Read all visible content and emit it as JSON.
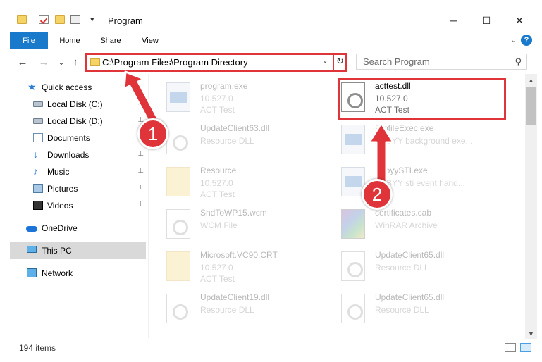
{
  "window": {
    "title": "Program",
    "minimize_glyph": "─",
    "maximize_glyph": "☐",
    "close_glyph": "✕",
    "qa_dropdown_glyph": "▾"
  },
  "ribbon": {
    "tabs": [
      "File",
      "Home",
      "Share",
      "View"
    ],
    "expand_glyph": "⌄",
    "help_glyph": "?"
  },
  "nav": {
    "back_glyph": "←",
    "forward_glyph": "→",
    "recent_glyph": "⌄",
    "up_glyph": "↑"
  },
  "address": {
    "path": "C:\\Program Files\\Program Directory",
    "dropdown_glyph": "⌄",
    "refresh_glyph": "↻"
  },
  "search": {
    "placeholder": "Search Program",
    "icon_glyph": "⚲"
  },
  "sidebar": {
    "items": [
      {
        "label": "Quick access",
        "icon": "star-icon",
        "pinned": false
      },
      {
        "label": "Local Disk (C:)",
        "icon": "disk-icon",
        "pinned": true
      },
      {
        "label": "Local Disk (D:)",
        "icon": "disk-icon",
        "pinned": true
      },
      {
        "label": "Documents",
        "icon": "documents-icon",
        "pinned": true
      },
      {
        "label": "Downloads",
        "icon": "download-icon",
        "pinned": true
      },
      {
        "label": "Music",
        "icon": "music-icon",
        "pinned": true
      },
      {
        "label": "Pictures",
        "icon": "pictures-icon",
        "pinned": true
      },
      {
        "label": "Videos",
        "icon": "videos-icon",
        "pinned": true
      },
      {
        "label": "OneDrive",
        "icon": "onedrive-icon",
        "pinned": false
      },
      {
        "label": "This PC",
        "icon": "computer-icon",
        "pinned": false,
        "selected": true
      },
      {
        "label": "Network",
        "icon": "network-icon",
        "pinned": false
      }
    ],
    "pin_glyph": "📌"
  },
  "files": [
    {
      "name": "program.exe",
      "line1": "10.527.0",
      "line2": "ACT Test",
      "icon": "exe-icon",
      "faded": true
    },
    {
      "name": "acttest.dll",
      "line1": "10.527.0",
      "line2": "ACT Test",
      "icon": "dll-icon",
      "faded": false,
      "highlighted": true
    },
    {
      "name": "UpdateClient63.dll",
      "line1": "Resource DLL",
      "line2": "",
      "icon": "dll-icon",
      "faded": true
    },
    {
      "name": "ProfileExec.exe",
      "line1": "ABBYY background exe...",
      "line2": "",
      "icon": "exe-icon",
      "faded": true
    },
    {
      "name": "Resource",
      "line1": "10.527.0",
      "line2": "ACT Test",
      "icon": "folder-icon",
      "faded": true
    },
    {
      "name": "AbbyySTI.exe",
      "line1": "ABBYY sti event hand...",
      "line2": "",
      "icon": "exe-icon",
      "faded": true
    },
    {
      "name": "SndToWP15.wcm",
      "line1": "WCM File",
      "line2": "",
      "icon": "file-icon",
      "faded": true
    },
    {
      "name": "certificates.cab",
      "line1": "WinRAR Archive",
      "line2": "",
      "icon": "cab-icon",
      "faded": true
    },
    {
      "name": "Microsoft.VC90.CRT",
      "line1": "10.527.0",
      "line2": "ACT Test",
      "icon": "folder-icon",
      "faded": true
    },
    {
      "name": "UpdateClient65.dll",
      "line1": "Resource DLL",
      "line2": "",
      "icon": "dll-icon",
      "faded": true
    },
    {
      "name": "UpdateClient19.dll",
      "line1": "Resource DLL",
      "line2": "",
      "icon": "dll-icon",
      "faded": true
    },
    {
      "name": "UpdateClient65.dll",
      "line1": "Resource DLL",
      "line2": "",
      "icon": "dll-icon",
      "faded": true
    }
  ],
  "annotations": {
    "marker1": "1",
    "marker2": "2",
    "accent_color": "#e0343b"
  },
  "status": {
    "count": "194 items"
  },
  "colors": {
    "file_tab": "#1979ca",
    "selection": "#d9d9d9",
    "highlight_red": "#e0343b"
  }
}
